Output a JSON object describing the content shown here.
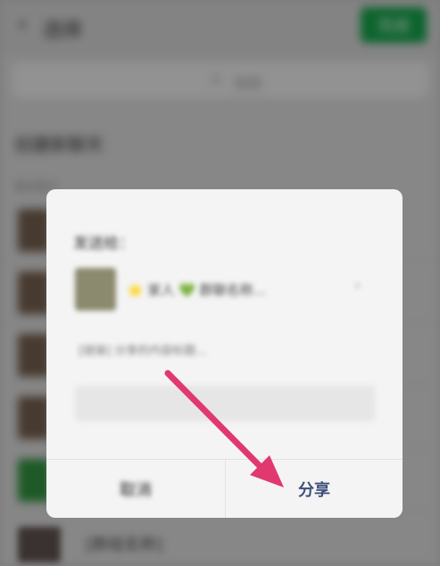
{
  "header": {
    "back_glyph": "‹",
    "title": "选择",
    "send_button": "完成"
  },
  "search": {
    "icon": "search-icon",
    "placeholder": "搜索"
  },
  "section": {
    "title": "创建新聊天",
    "subtitle": "最近聊天"
  },
  "list": {
    "rows": [
      {
        "label": ""
      },
      {
        "label": ""
      },
      {
        "label": ""
      },
      {
        "label": ""
      },
      {
        "label": ""
      }
    ],
    "bottom_label": "[群组名称]"
  },
  "dialog": {
    "send_to_label": "发送给：",
    "recipient_name": "⭐ 家人 💚 群聊名称...",
    "recipient_chevron": "›",
    "message_preview": "[链接] 分享的内容标题...",
    "cancel_label": "取消",
    "share_label": "分享"
  },
  "colors": {
    "accent_green": "#139a45",
    "share_text": "#3e4f7a",
    "arrow": "#e0386f"
  }
}
